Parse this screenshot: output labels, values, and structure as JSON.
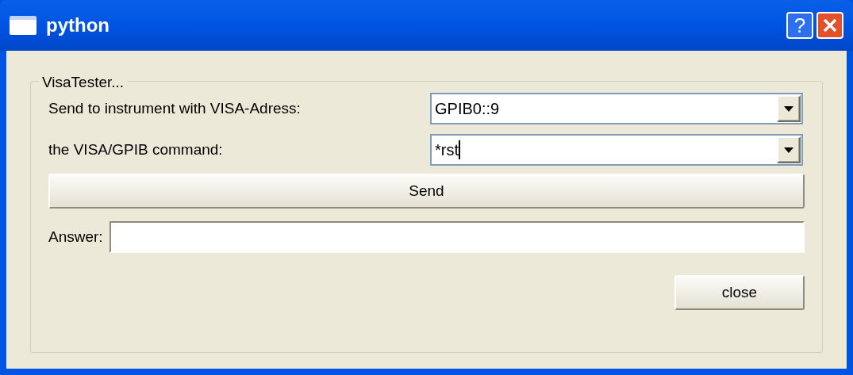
{
  "window": {
    "title": "python",
    "help_button": "?"
  },
  "group": {
    "title": "VisaTester...",
    "fields": [
      {
        "label": "Send to instrument with VISA-Adress:",
        "value": "GPIB0::9",
        "focused": false
      },
      {
        "label": "the VISA/GPIB command:",
        "value": "*rst",
        "focused": true
      }
    ],
    "send_button": "Send",
    "answer": {
      "label": "Answer:"
    },
    "close_button": "close"
  }
}
